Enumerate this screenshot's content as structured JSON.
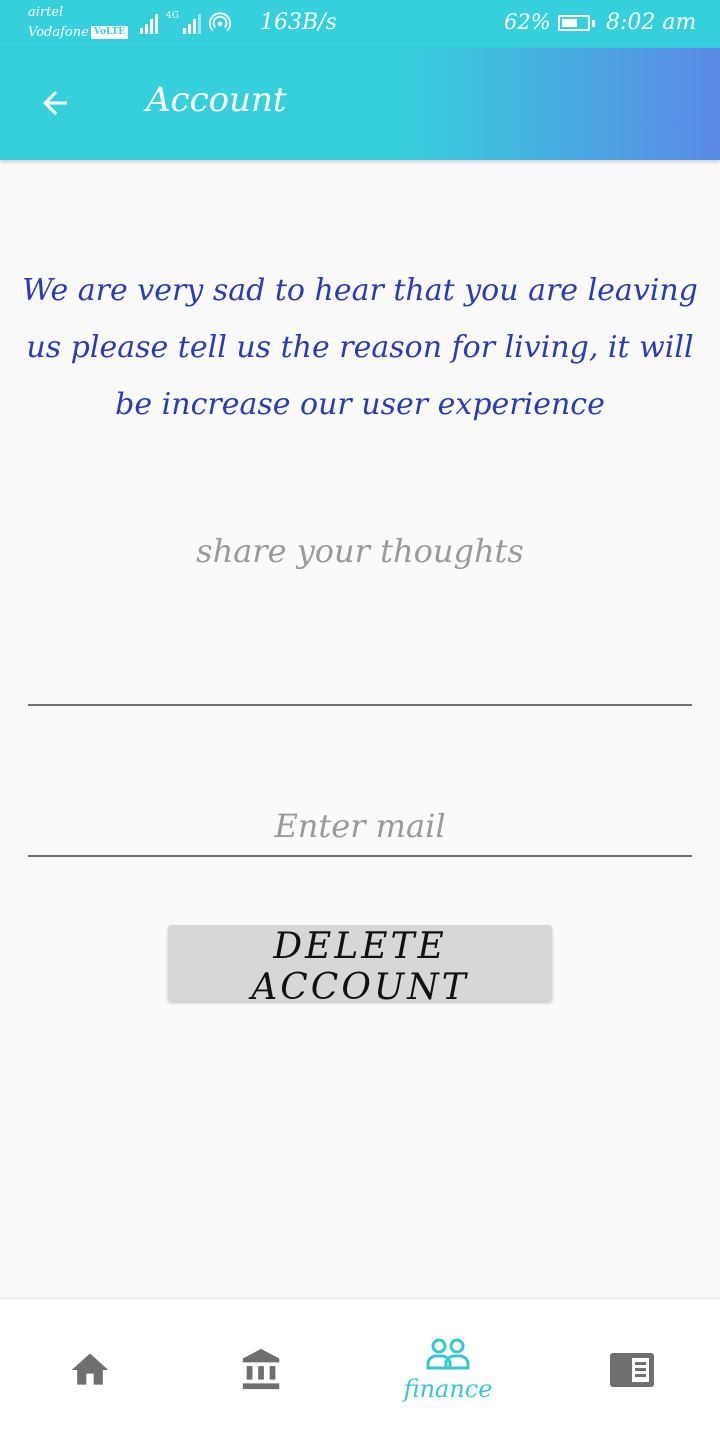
{
  "status_bar": {
    "carrier_1": "airtel",
    "carrier_2": "Vodafone",
    "volte": "VoLTE",
    "network_type": "4G",
    "net_speed": "163B/s",
    "battery_percent": "62%",
    "battery_level": 0.62,
    "time": "8:02 am"
  },
  "app_bar": {
    "title": "Account",
    "back_icon": "arrow-left-icon"
  },
  "main": {
    "message_lines": [
      "We are very sad to hear that you are leaving",
      "us please tell us the reason for living, it will",
      "be increase our user experience"
    ],
    "thoughts_placeholder": "share your thoughts",
    "thoughts_value": "",
    "mail_placeholder": "Enter mail",
    "mail_value": "",
    "delete_button_label": "DELETE ACCOUNT"
  },
  "bottom_nav": {
    "items": [
      {
        "icon": "home-icon",
        "label": ""
      },
      {
        "icon": "bank-icon",
        "label": ""
      },
      {
        "icon": "people-icon",
        "label": "finance",
        "active": true
      },
      {
        "icon": "news-icon",
        "label": ""
      }
    ]
  },
  "colors": {
    "primary": "#36d0dc",
    "gradient_end": "#5a89e6",
    "message_text": "#2a3bb3",
    "active_nav": "#36c7d1",
    "inactive_nav": "#6f6f6f"
  }
}
